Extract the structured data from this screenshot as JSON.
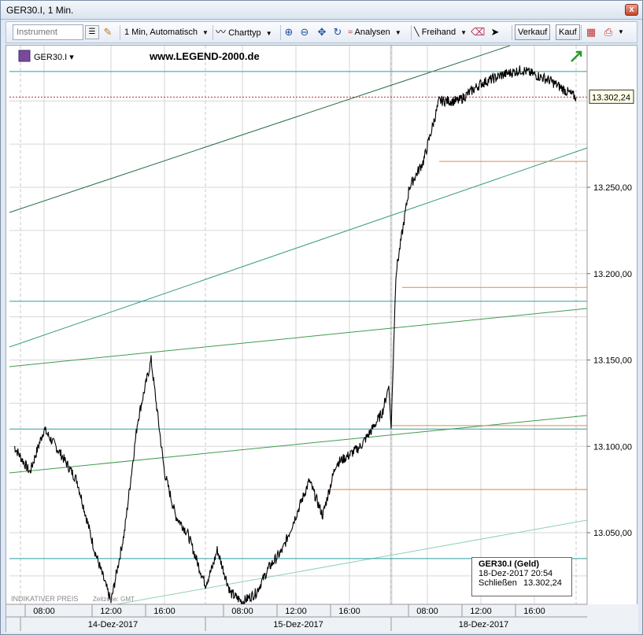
{
  "window": {
    "title": "GER30.I, 1 Min.",
    "close_label": "x"
  },
  "toolbar": {
    "instrument_placeholder": "Instrument",
    "interval_label": "1 Min,",
    "scale_label": "Automatisch",
    "charttype_label": "Charttyp",
    "analysen_label": "Analysen",
    "freihand_label": "Freihand",
    "verkauf_label": "Verkauf",
    "kauf_label": "Kauf"
  },
  "chart": {
    "symbol": "GER30.I",
    "watermark": "www.LEGEND-2000.de",
    "indicative_note": "INDIKATIVER PREIS",
    "timezone_note": "Zeitzone: GMT",
    "current_price": "13.302,24",
    "price_ticks": [
      "13.250,00",
      "13.200,00",
      "13.150,00",
      "13.100,00",
      "13.050,00"
    ],
    "time_ticks": [
      "08:00",
      "12:00",
      "16:00",
      "08:00",
      "12:00",
      "16:00",
      "08:00",
      "12:00",
      "16:00"
    ],
    "date_labels": [
      "14-Dez-2017",
      "15-Dez-2017",
      "18-Dez-2017"
    ]
  },
  "info_box": {
    "title": "GER30.I (Geld)",
    "datetime": "18-Dez-2017 20:54",
    "close_label": "Schließen",
    "close_value": "13.302,24"
  },
  "colors": {
    "price_line": "#000000",
    "horizontal_teal": "#2f9ea0",
    "support_orange": "#e08a4a",
    "trend_dark_green": "#2d6b45",
    "trend_green": "#3f9b4f",
    "trend_teal": "#3a9a84",
    "trend_light_teal": "#8fd0b8",
    "current_price_line": "#b03030"
  },
  "chart_data": {
    "type": "line",
    "title": "",
    "xlabel": "",
    "ylabel": "",
    "ylim": [
      13000,
      13325
    ],
    "x": [
      "14-Dez 06:00",
      "14-Dez 07:00",
      "14-Dez 08:00",
      "14-Dez 09:00",
      "14-Dez 10:00",
      "14-Dez 11:00",
      "14-Dez 12:00",
      "14-Dez 13:00",
      "14-Dez 14:00",
      "14-Dez 15:00",
      "14-Dez 16:00",
      "14-Dez 17:00",
      "14-Dez 18:00",
      "14-Dez 19:00",
      "14-Dez 20:00",
      "14-Dez 21:00",
      "15-Dez 06:00",
      "15-Dez 07:00",
      "15-Dez 08:00",
      "15-Dez 09:00",
      "15-Dez 10:00",
      "15-Dez 11:00",
      "15-Dez 12:00",
      "15-Dez 13:00",
      "15-Dez 14:00",
      "15-Dez 15:00",
      "15-Dez 16:00",
      "15-Dez 17:00",
      "15-Dez 18:00",
      "15-Dez 19:00",
      "15-Dez 20:00",
      "15-Dez 21:00",
      "18-Dez 02:00",
      "18-Dez 04:00",
      "18-Dez 06:00",
      "18-Dez 08:00",
      "18-Dez 10:00",
      "18-Dez 12:00",
      "18-Dez 14:00",
      "18-Dez 16:00",
      "18-Dez 18:00",
      "18-Dez 20:00"
    ],
    "series": [
      {
        "values": [
          13100,
          13085,
          13110,
          13095,
          13080,
          13040,
          13010,
          13050,
          13115,
          13150,
          13085,
          13060,
          13050,
          13030,
          13020,
          13030,
          13040,
          13015,
          13010,
          13015,
          13030,
          13040,
          13060,
          13080,
          13060,
          13090,
          13095,
          13100,
          13110,
          13120,
          13135,
          13110,
          13200,
          13250,
          13265,
          13300,
          13300,
          13310,
          13315,
          13318,
          13312,
          13302
        ]
      }
    ],
    "horizontal_levels": [
      13317,
      13302.24,
      13265,
      13192,
      13184,
      13112,
      13110,
      13075,
      13035
    ]
  }
}
